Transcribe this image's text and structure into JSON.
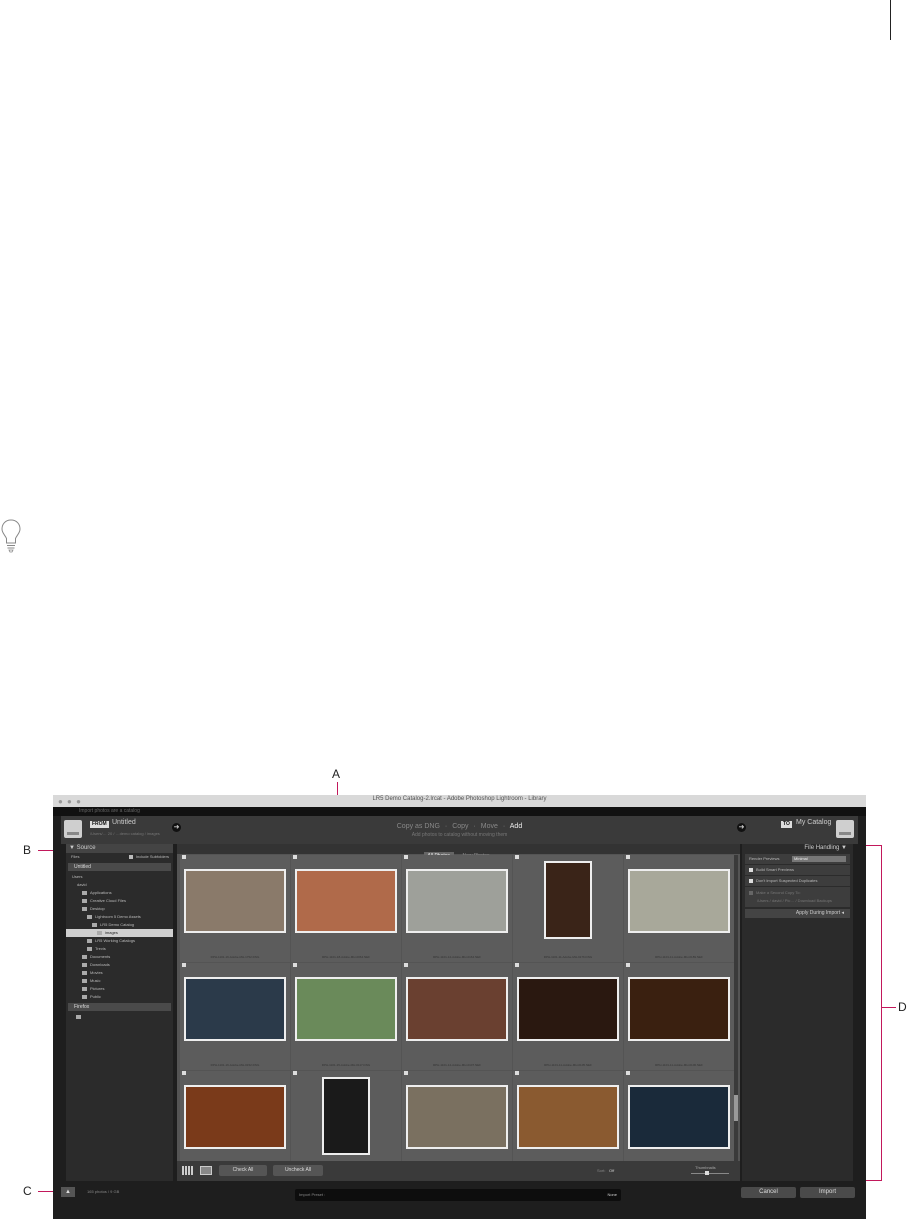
{
  "callouts": {
    "a": "A",
    "b": "B",
    "c": "C",
    "d": "D"
  },
  "window": {
    "title": "LR5 Demo Catalog-2.lrcat - Adobe Photoshop Lightroom - Library",
    "subtitle": "Import photos are a catalog"
  },
  "header": {
    "from_badge": "FROM",
    "from_label": "Untitled",
    "from_sub": "/Users/… 20 / …demo catalog / images",
    "modes": [
      "Copy as DNG",
      "Copy",
      "Move"
    ],
    "active_mode": "Add",
    "mode_description": "Add photos to catalog without moving them",
    "to_badge": "TO",
    "to_label": "My Catalog"
  },
  "source": {
    "title": "Source",
    "files_label": "Files",
    "include_subfolders": "Include Subfolders",
    "sections": [
      "Untitled",
      "Firefox"
    ],
    "tree": [
      {
        "label": "Users",
        "depth": 0,
        "kind": "text"
      },
      {
        "label": "david",
        "depth": 1,
        "kind": "text"
      },
      {
        "label": "Applications",
        "depth": 2,
        "kind": "folder"
      },
      {
        "label": "Creative Cloud Files",
        "depth": 2,
        "kind": "folder"
      },
      {
        "label": "Desktop",
        "depth": 2,
        "kind": "folder"
      },
      {
        "label": "Lightroom 5 Demo Assets",
        "depth": 3,
        "kind": "folder"
      },
      {
        "label": "LR5 Demo Catalog",
        "depth": 4,
        "kind": "folder"
      },
      {
        "label": "images",
        "depth": 5,
        "kind": "folder",
        "selected": true
      },
      {
        "label": "LR5 Working Catalogs",
        "depth": 3,
        "kind": "folder"
      },
      {
        "label": "Trevis",
        "depth": 3,
        "kind": "folder"
      },
      {
        "label": "Documents",
        "depth": 2,
        "kind": "folder"
      },
      {
        "label": "Downloads",
        "depth": 2,
        "kind": "folder"
      },
      {
        "label": "Movies",
        "depth": 2,
        "kind": "folder"
      },
      {
        "label": "Music",
        "depth": 2,
        "kind": "folder"
      },
      {
        "label": "Pictures",
        "depth": 2,
        "kind": "folder"
      },
      {
        "label": "Public",
        "depth": 2,
        "kind": "folder"
      }
    ]
  },
  "tabs": [
    "All Photos",
    "New Photos"
  ],
  "photos": [
    {
      "file": "RPH-1101-16-Adobe-MH-1752.DNG",
      "color": "#8a7a6a"
    },
    {
      "file": "RPH-1101-18-Adobe-MH-0064.NEF",
      "color": "#b06a4a"
    },
    {
      "file": "RPH-1101-12-Adobe-MH-0164.NEF",
      "color": "#9ea09a"
    },
    {
      "file": "RPH-1101-11-Adobe-MH-0176.DNG",
      "color": "#3a2418"
    },
    {
      "file": "RPH-1101-11-Adobe-MH-0189.NEF",
      "color": "#a8a89a"
    },
    {
      "file": "RPH-1101-16-Adobe-MH-0152.DNG",
      "color": "#2b3a4a"
    },
    {
      "file": "RPH-1101-15-Adobe-MH-0117.DNG",
      "color": "#6a8a5a"
    },
    {
      "file": "RPH-1101-12-Adobe-MH-0107.NEF",
      "color": "#6a4030"
    },
    {
      "file": "RPH-1101-11-Adobe-MH-0105.NEF",
      "color": "#2a1810"
    },
    {
      "file": "RPH-1101-11-Adobe-MH-0106.NEF",
      "color": "#3a2010"
    },
    {
      "file": "RPH-1101-16-Adobe-MH-0188.DNG",
      "color": "#7a3a1a"
    },
    {
      "file": "RPH-1101-18-Adobe-MH-0094.NEF",
      "color": "#1a1a1a"
    },
    {
      "file": "RPH-1101-12-Adobe-MH-0128.NEF",
      "color": "#7a7060"
    },
    {
      "file": "RPH-1101-11-Adobe-MH-0144.NEF",
      "color": "#8a5a30"
    },
    {
      "file": "RPH-1101-11-Adobe-MH-0146.NEF",
      "color": "#1a2a3a"
    }
  ],
  "toolbar": {
    "check_all": "Check All",
    "uncheck_all": "Uncheck All",
    "sort_label": "Sort:",
    "sort_value": "Off",
    "thumbnails_label": "Thumbnails"
  },
  "file_handling": {
    "title": "File Handling",
    "render_previews_label": "Render Previews",
    "render_previews_value": "Minimal",
    "build_smart_previews": "Build Smart Previews",
    "dont_import_duplicates": "Don't Import Suspected Duplicates",
    "make_second_copy": "Make a Second Copy To:",
    "second_copy_path": "/Users / david / Pic… / Download Backups",
    "apply_during_import": "Apply During Import"
  },
  "bottom": {
    "photo_count": "165 photos / 9 GB",
    "import_preset_label": "Import Preset :",
    "import_preset_value": "None",
    "cancel": "Cancel",
    "import": "Import"
  }
}
